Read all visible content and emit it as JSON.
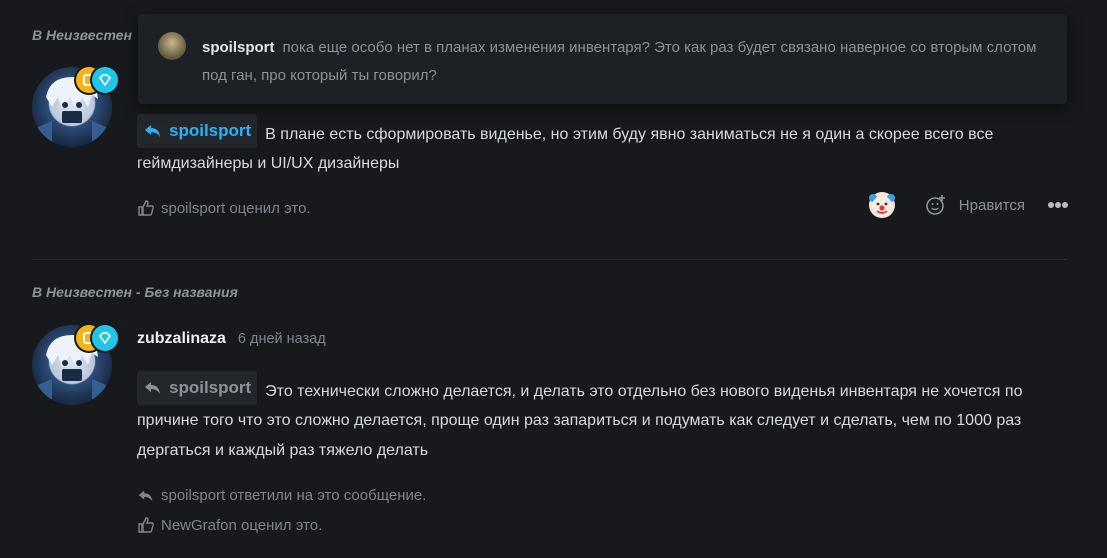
{
  "post1": {
    "channel_prefix": "В",
    "channel_name": "Неизвестен",
    "quote_popover": {
      "author": "spoilsport",
      "text": "пока еще особо нет в планах изменения инвентаря? Это как раз будет связано наверное со вторым слотом под ган, про который ты говорил?"
    },
    "reply_to": "spoilsport",
    "message": "В плане есть сформировать виденье, но этим буду явно заниматься не я один а скорее всего все геймдизайнеры и UI/UX дизайнеры",
    "reaction_line": "spoilsport оценил это.",
    "like_label": "Нравится"
  },
  "post2": {
    "channel_prefix": "В",
    "channel_name": "Неизвестен - Без названия",
    "author": "zubzalinaza",
    "time": "6 дней назад",
    "reply_to": "spoilsport",
    "message": "Это технически сложно делается, и делать это отдельно без нового виденья инвентаря не хочется по причине того что это сложно делается, проще один раз запариться и подумать как следует и сделать, чем по 1000 раз дергаться и каждый раз тяжело делать",
    "replied_line": "spoilsport ответили на это сообщение.",
    "reaction_line": "NewGrafon оценил это."
  },
  "icons": {
    "reply": "reply-arrow-icon",
    "like": "thumbs-up-icon",
    "add_reaction": "add-reaction-icon",
    "more": "more-dots-icon",
    "clown_reaction": "clown-emoji-icon"
  },
  "colors": {
    "background": "#17191d",
    "accent_blue": "#2db1f5",
    "badge_gold": "#f6b417",
    "badge_cyan": "#20c5e8"
  }
}
